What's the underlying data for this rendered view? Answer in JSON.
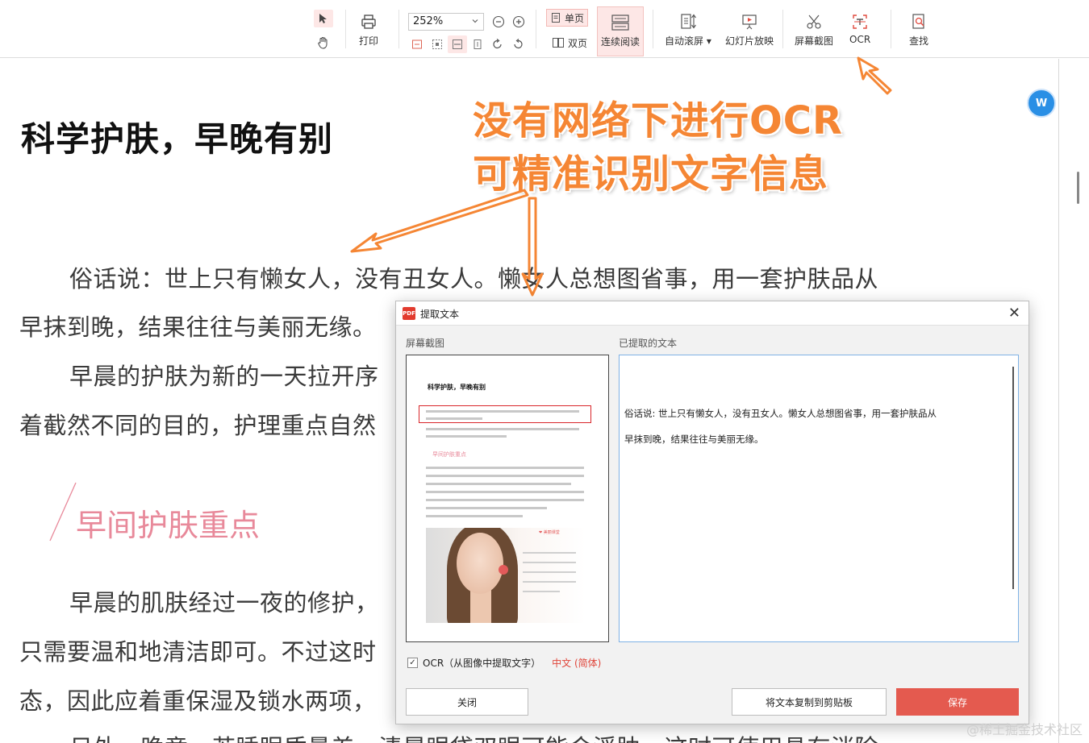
{
  "toolbar": {
    "zoom_value": "252%",
    "print_label": "打印",
    "single_page_label": "单页",
    "double_page_label": "双页",
    "continuous_label": "连续阅读",
    "auto_scroll_label": "自动滚屏",
    "slideshow_label": "幻灯片放映",
    "screenshot_label": "屏幕截图",
    "ocr_label": "OCR",
    "find_label": "查找"
  },
  "document": {
    "title": "科学护肤，早晚有别",
    "lines": [
      "俗话说：世上只有懒女人，没有丑女人。懒女人总想图省事，用一套护肤品从",
      "早抹到晚，结果往往与美丽无缘。",
      "早晨的护肤为新的一天拉开序",
      "着截然不同的目的，护理重点自然",
      "早晨的肌肤经过一夜的修护，",
      "只需要温和地清洁即可。不过这时",
      "态，因此应着重保湿及锁水两项，",
      "日外，晚竟，若睡眠质量差，清晨眼袋双眼可能会浮肿，这时可使用具有消除"
    ],
    "section_heading": "早间护肤重点"
  },
  "annotation": {
    "line1": "没有网络下进行OCR",
    "line2": "可精准识别文字信息",
    "color": "#f58634"
  },
  "dialog": {
    "title": "提取文本",
    "left_label": "屏幕截图",
    "right_label": "已提取的文本",
    "thumbnail": {
      "title": "科学护肤，早晚有别",
      "section": "早间护肤重点",
      "badge": "❤ 美丽课堂"
    },
    "extracted_lines": [
      "俗话说: 世上只有懒女人，没有丑女人。懒女人总想图省事，用一套护肤品从",
      "早抹到晚，结果往往与美丽无缘。"
    ],
    "ocr_checkbox_label": "OCR（从图像中提取文字）",
    "ocr_checked": true,
    "language_label": "中文 (简体)",
    "close_button": "关闭",
    "copy_button": "将文本复制到剪贴板",
    "save_button": "保存"
  },
  "float_icon": "W",
  "watermark": "@稀土掘金技术社区"
}
